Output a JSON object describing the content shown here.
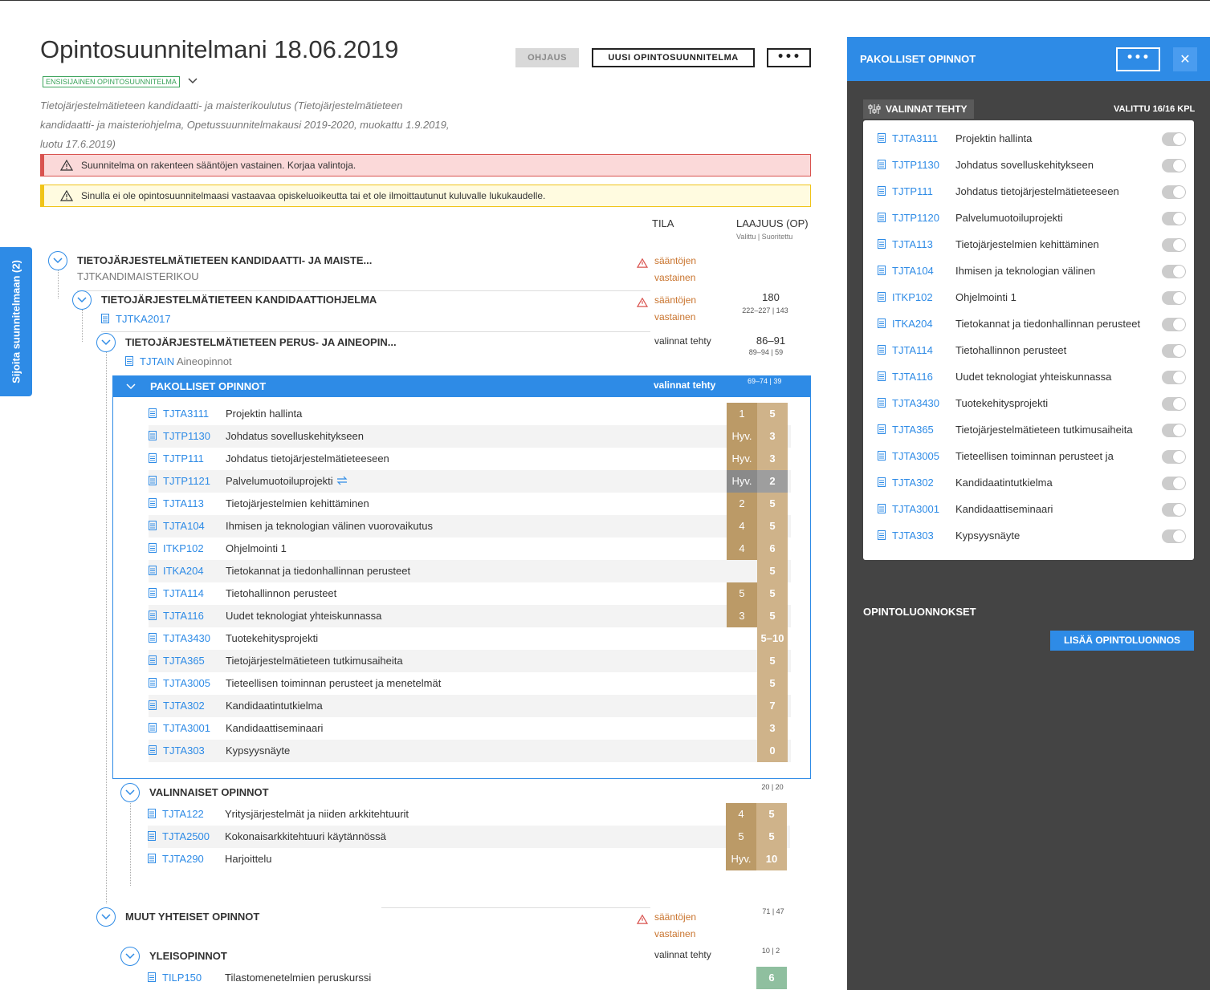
{
  "page": {
    "title": "Opintosuunnitelmani 18.06.2019",
    "badge": "ENSISIJAINEN OPINTOSUUNNITELMA",
    "description": "Tietojärjestelmätieteen kandidaatti- ja maisterikoulutus (Tietojärjestelmätieteen kandidaatti- ja maisteriohjelma, Opetussuunnitelmakausi 2019-2020, muokattu 1.9.2019, luotu 17.6.2019)",
    "buttons": {
      "ohjaus": "OHJAUS",
      "uusi": "UUSI OPINTOSUUNNITELMA",
      "more": "•••"
    },
    "alerts": {
      "error": "Suunnitelma on rakenteen sääntöjen vastainen. Korjaa valintoja.",
      "warning": "Sinulla ei ole opintosuunnitelmaasi vastaavaa opiskeluoikeutta tai et ole ilmoittautunut kuluvalle lukukaudelle."
    },
    "side_tab": "Sijoita suunnitelmaan (2)",
    "columns": {
      "tila": "TILA",
      "laajuus": "LAAJUUS (OP)",
      "laajuus_sub": "Valittu | Suoritettu"
    }
  },
  "tree": {
    "root": {
      "title": "TIETOJÄRJESTELMÄTIETEEN KANDIDAATTI- JA MAISTE...",
      "code": "TJTKANDIMAISTERIKOU",
      "status_line1": "sääntöjen",
      "status_line2": "vastainen"
    },
    "kand": {
      "title": "TIETOJÄRJESTELMÄTIETEEN KANDIDAATTIOHJELMA",
      "code": "TJTKA2017",
      "status_line1": "sääntöjen",
      "status_line2": "vastainen",
      "big": "180",
      "small": "222–227 | 143"
    },
    "perus": {
      "title": "TIETOJÄRJESTELMÄTIETEEN PERUS- JA AINEOPIN...",
      "code": "TJTAIN",
      "code_suffix": "Aineopinnot",
      "status": "valinnat tehty",
      "big": "86–91",
      "small": "89–94 | 59"
    },
    "pakolliset": {
      "title": "PAKOLLISET OPINNOT",
      "status": "valinnat tehty",
      "small": "69–74 | 39"
    },
    "valinnaiset": {
      "title": "VALINNAISET OPINNOT",
      "small": "20 | 20"
    },
    "muut": {
      "title": "MUUT YHTEISET OPINNOT",
      "status_line1": "sääntöjen",
      "status_line2": "vastainen",
      "small": "71 | 47"
    },
    "yleis": {
      "title": "YLEISOPINNOT",
      "status": "valinnat tehty",
      "small": "10 | 2"
    }
  },
  "pakolliset_courses": [
    {
      "code": "TJTA3111",
      "name": "Projektin hallinta",
      "grade": "1",
      "credits": "5"
    },
    {
      "code": "TJTP1130",
      "name": "Johdatus sovelluskehitykseen",
      "grade": "Hyv.",
      "credits": "3"
    },
    {
      "code": "TJTP111",
      "name": "Johdatus tietojärjestelmätieteeseen",
      "grade": "Hyv.",
      "credits": "3"
    },
    {
      "code": "TJTP1121",
      "name": "Palvelumuotoiluprojekti",
      "grade": "Hyv.",
      "credits": "2"
    },
    {
      "code": "TJTA113",
      "name": "Tietojärjestelmien kehittäminen",
      "grade": "2",
      "credits": "5"
    },
    {
      "code": "TJTA104",
      "name": "Ihmisen ja teknologian välinen vuorovaikutus",
      "grade": "4",
      "credits": "5"
    },
    {
      "code": "ITKP102",
      "name": "Ohjelmointi 1",
      "grade": "4",
      "credits": "6"
    },
    {
      "code": "ITKA204",
      "name": "Tietokannat ja tiedonhallinnan perusteet",
      "grade": "",
      "credits": "5"
    },
    {
      "code": "TJTA114",
      "name": "Tietohallinnon perusteet",
      "grade": "5",
      "credits": "5"
    },
    {
      "code": "TJTA116",
      "name": "Uudet teknologiat yhteiskunnassa",
      "grade": "3",
      "credits": "5"
    },
    {
      "code": "TJTA3430",
      "name": "Tuotekehitysprojekti",
      "grade": "",
      "credits": "5–10"
    },
    {
      "code": "TJTA365",
      "name": "Tietojärjestelmätieteen tutkimusaiheita",
      "grade": "",
      "credits": "5"
    },
    {
      "code": "TJTA3005",
      "name": "Tieteellisen toiminnan perusteet ja menetelmät",
      "grade": "",
      "credits": "5"
    },
    {
      "code": "TJTA302",
      "name": "Kandidaatintutkielma",
      "grade": "",
      "credits": "7"
    },
    {
      "code": "TJTA3001",
      "name": "Kandidaattiseminaari",
      "grade": "",
      "credits": "3"
    },
    {
      "code": "TJTA303",
      "name": "Kypsyysnäyte",
      "grade": "",
      "credits": "0"
    }
  ],
  "valinnaiset_courses": [
    {
      "code": "TJTA122",
      "name": "Yritysjärjestelmät ja niiden arkkitehtuurit",
      "grade": "4",
      "credits": "5"
    },
    {
      "code": "TJTA2500",
      "name": "Kokonaisarkkitehtuuri käytännössä",
      "grade": "5",
      "credits": "5"
    },
    {
      "code": "TJTA290",
      "name": "Harjoittelu",
      "grade": "Hyv.",
      "credits": "10"
    }
  ],
  "yleis_courses": [
    {
      "code": "TILP150",
      "name": "Tilastomenetelmien peruskurssi",
      "grade": "",
      "credits": "6"
    }
  ],
  "panel": {
    "title": "PAKOLLISET OPINNOT",
    "more": "•••",
    "close": "✕",
    "tag": "VALINNAT TEHTY",
    "count": "VALITTU 16/16 KPL",
    "items": [
      {
        "code": "TJTA3111",
        "name": "Projektin hallinta"
      },
      {
        "code": "TJTP1130",
        "name": "Johdatus sovelluskehitykseen"
      },
      {
        "code": "TJTP111",
        "name": "Johdatus tietojärjestelmätieteeseen"
      },
      {
        "code": "TJTP1120",
        "name": "Palvelumuotoiluprojekti"
      },
      {
        "code": "TJTA113",
        "name": "Tietojärjestelmien kehittäminen"
      },
      {
        "code": "TJTA104",
        "name": "Ihmisen ja teknologian välinen"
      },
      {
        "code": "ITKP102",
        "name": "Ohjelmointi 1"
      },
      {
        "code": "ITKA204",
        "name": "Tietokannat ja tiedonhallinnan perusteet"
      },
      {
        "code": "TJTA114",
        "name": "Tietohallinnon perusteet"
      },
      {
        "code": "TJTA116",
        "name": "Uudet teknologiat yhteiskunnassa"
      },
      {
        "code": "TJTA3430",
        "name": "Tuotekehitysprojekti"
      },
      {
        "code": "TJTA365",
        "name": "Tietojärjestelmätieteen tutkimusaiheita"
      },
      {
        "code": "TJTA3005",
        "name": "Tieteellisen toiminnan perusteet ja"
      },
      {
        "code": "TJTA302",
        "name": "Kandidaatintutkielma"
      },
      {
        "code": "TJTA3001",
        "name": "Kandidaattiseminaari"
      },
      {
        "code": "TJTA303",
        "name": "Kypsyysnäyte"
      }
    ],
    "section": "OPINTOLUONNOKSET",
    "add_button": "LISÄÄ OPINTOLUONNOS"
  }
}
